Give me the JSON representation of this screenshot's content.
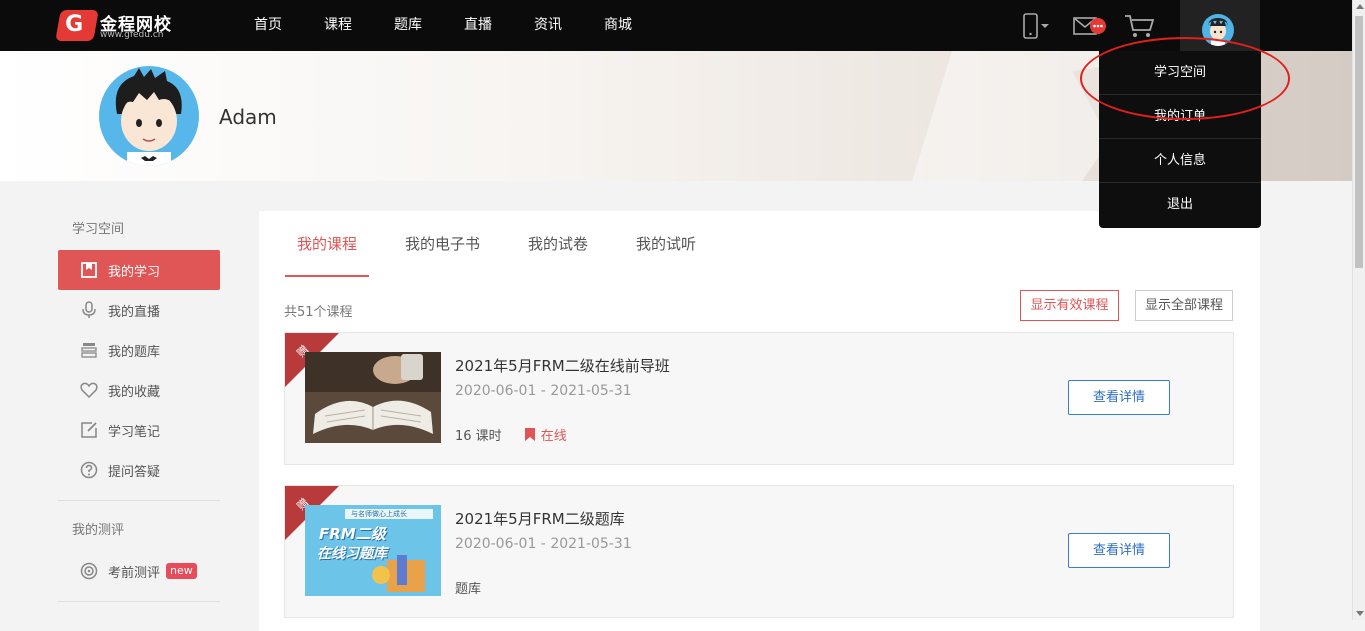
{
  "header": {
    "logo_mark": "G",
    "logo_name": "金程网校",
    "logo_url": "www.gfedu.cn",
    "nav": [
      "首页",
      "课程",
      "题库",
      "直播",
      "资讯",
      "商城"
    ]
  },
  "profile": {
    "name": "Adam"
  },
  "user_menu": {
    "items": [
      "学习空间",
      "我的订单",
      "个人信息",
      "退出"
    ]
  },
  "sidebar": {
    "section1_title": "学习空间",
    "items": [
      "我的学习",
      "我的直播",
      "我的题库",
      "我的收藏",
      "学习笔记",
      "提问答疑"
    ],
    "section2_title": "我的测评",
    "eval_item": "考前测评",
    "new_badge": "new"
  },
  "main": {
    "tabs": [
      "我的课程",
      "我的电子书",
      "我的试卷",
      "我的试听"
    ],
    "count_text": "共51个课程",
    "filter_valid": "显示有效课程",
    "filter_all": "显示全部课程",
    "courses": [
      {
        "corner": "赠",
        "title": "2021年5月FRM二级在线前导班",
        "date": "2020-06-01 - 2021-05-31",
        "lessons": "16 课时",
        "status": "在线",
        "button": "查看详情"
      },
      {
        "corner": "赠",
        "title": "2021年5月FRM二级题库",
        "date": "2020-06-01 - 2021-05-31",
        "type": "题库",
        "thumb_top": "与名师做心上成长",
        "thumb_line1": "FRM二级",
        "thumb_line2": "在线习题库",
        "button": "查看详情"
      }
    ]
  },
  "colors": {
    "accent": "#e05555",
    "topbar": "#0b0b0b",
    "link_blue": "#2f6ec2",
    "callout": "#e0201b"
  }
}
